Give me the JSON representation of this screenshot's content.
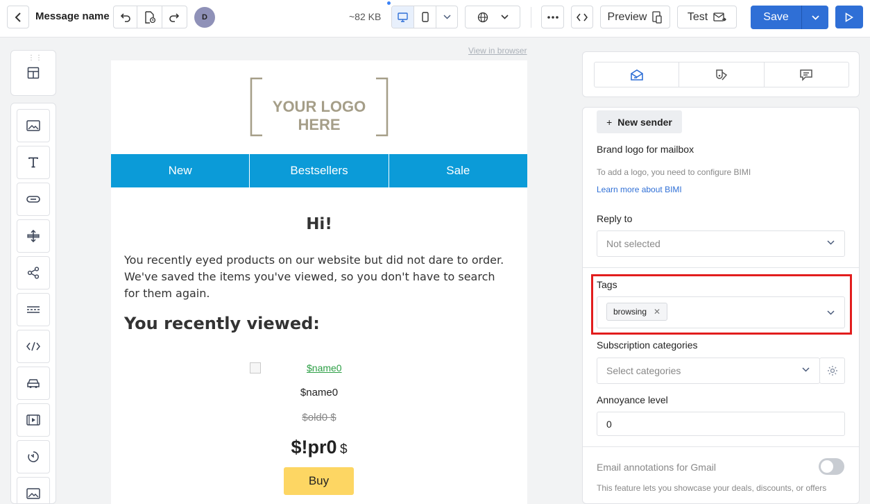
{
  "topbar": {
    "title": "Message name",
    "avatar_initial": "D",
    "size": "~82 KB",
    "preview_label": "Preview",
    "test_label": "Test",
    "save_label": "Save"
  },
  "left_toolbar": {
    "items": [
      "image-icon",
      "text-icon",
      "button-icon",
      "spacer-icon",
      "social-icon",
      "divider-icon",
      "html-icon",
      "product-icon",
      "video-icon",
      "timer-icon",
      "image-icon"
    ]
  },
  "email": {
    "view_in_browser": "View in browser",
    "logo_text": "YOUR LOGO HERE",
    "menu": [
      "New",
      "Bestsellers",
      "Sale"
    ],
    "greeting": "Hi!",
    "intro": "You recently eyed products on our website but did not dare to order. We've saved the items you've viewed, so you don't have to search for them again.",
    "recent_title": "You recently viewed:",
    "product": {
      "link_text": "$name0",
      "name": "$name0",
      "old_price": "$old0 $",
      "price": "$!pr0",
      "currency": "$",
      "buy_label": "Buy"
    }
  },
  "settings": {
    "new_sender_label": "New sender",
    "brand_logo_label": "Brand logo for mailbox",
    "bimi_note": "To add a logo, you need to configure BIMI",
    "bimi_link": "Learn more about BIMI",
    "reply_to_label": "Reply to",
    "reply_to_value": "Not selected",
    "tags_label": "Tags",
    "tags": [
      "browsing"
    ],
    "subscription_label": "Subscription categories",
    "subscription_placeholder": "Select categories",
    "annoyance_label": "Annoyance level",
    "annoyance_value": "0",
    "gmail_label": "Email annotations for Gmail",
    "gmail_enabled": false,
    "gmail_note": "This feature lets you showcase your deals, discounts, or offers"
  },
  "colors": {
    "accent": "#2f6fd6",
    "menu_bg": "#0b9bd8",
    "buy_button": "#fdd663",
    "highlight": "#e21d1d"
  }
}
